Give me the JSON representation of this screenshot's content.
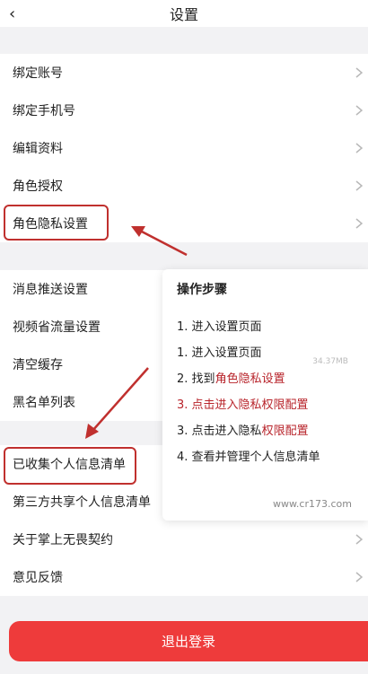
{
  "header": {
    "title": "设置",
    "back_icon": "back-icon"
  },
  "group1": {
    "items": [
      {
        "label": "绑定账号"
      },
      {
        "label": "绑定手机号"
      },
      {
        "label": "编辑资料"
      },
      {
        "label": "角色授权"
      },
      {
        "label": "角色隐私设置"
      }
    ]
  },
  "group2": {
    "items": [
      {
        "label": "消息推送设置"
      },
      {
        "label": "视频省流量设置"
      },
      {
        "label": "清空缓存"
      },
      {
        "label": "黑名单列表"
      }
    ],
    "cache_size": "34.37MB"
  },
  "group3": {
    "items": [
      {
        "label": "已收集个人信息清单"
      },
      {
        "label": "第三方共享个人信息清单"
      },
      {
        "label": "关于掌上无畏契约"
      },
      {
        "label": "意见反馈"
      }
    ]
  },
  "panel": {
    "title": "操作步骤",
    "steps": [
      {
        "num": "1.",
        "text": "进入设置页面"
      },
      {
        "num": "1.",
        "text": "进入设置页面"
      },
      {
        "num": "2.",
        "pre": "找到",
        "hl": "角色隐私设置"
      },
      {
        "num": "3.",
        "text": "点击进入隐私权限配置"
      },
      {
        "num": "3.",
        "pre": "点击进入隐私",
        "hl": "权限配置"
      },
      {
        "num": "4.",
        "text": "查看并管理个人信息清单"
      }
    ],
    "watermark": "www.cr173.com"
  },
  "logout": {
    "label": "退出登录"
  },
  "colors": {
    "accent": "#ee3b3b",
    "annotation": "#c0302e"
  }
}
